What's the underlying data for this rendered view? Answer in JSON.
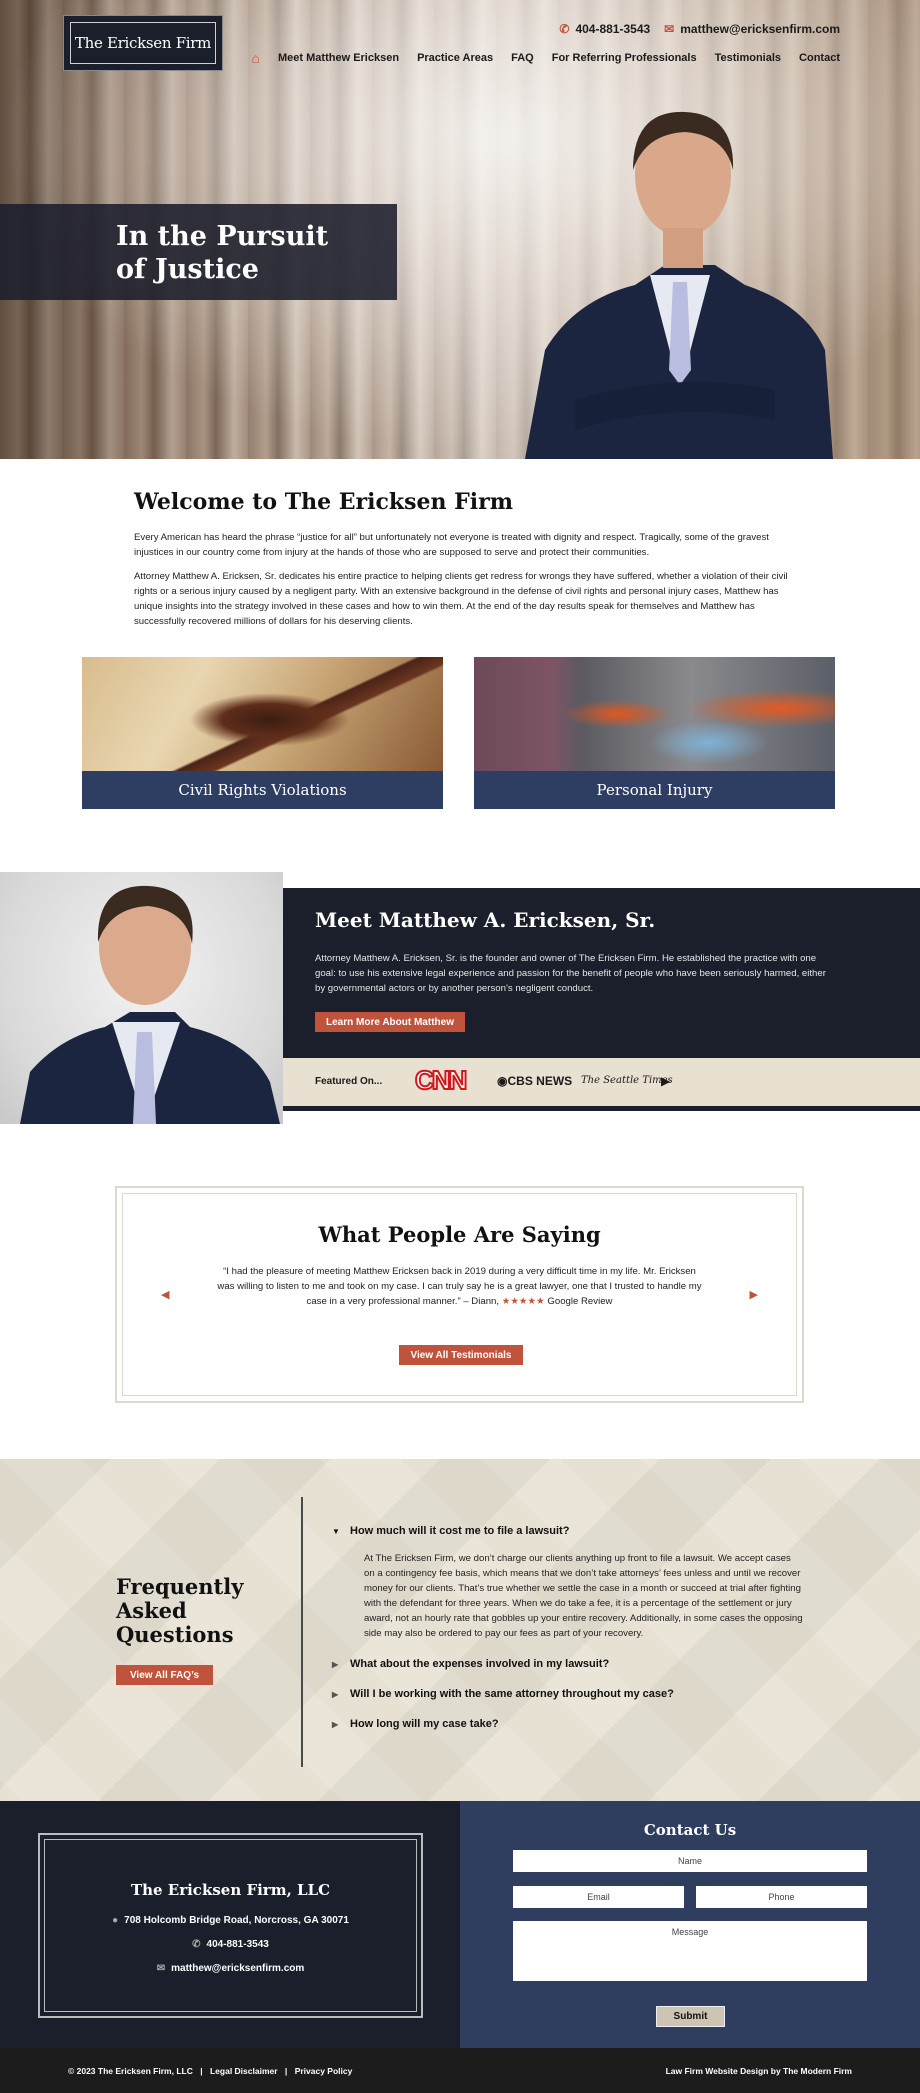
{
  "header": {
    "logo_text": "The Ericksen Firm",
    "phone": "404-881-3543",
    "email": "matthew@ericksenfirm.com",
    "nav": [
      {
        "label": "Meet Matthew Ericksen"
      },
      {
        "label": "Practice Areas"
      },
      {
        "label": "FAQ"
      },
      {
        "label": "For Referring Professionals"
      },
      {
        "label": "Testimonials"
      },
      {
        "label": "Contact"
      }
    ]
  },
  "hero": {
    "headline_line1": "In the Pursuit",
    "headline_line2": "of Justice"
  },
  "welcome": {
    "title": "Welcome to The Ericksen Firm",
    "paragraph1": "Every American has heard the phrase “justice for all” but unfortunately not everyone is treated with dignity and respect. Tragically, some of the gravest injustices in our country come from injury at the hands of those who are supposed to serve and protect their communities.",
    "paragraph2": "Attorney Matthew A. Ericksen, Sr. dedicates his entire practice to helping clients get redress for wrongs they have suffered, whether a violation of their civil rights or a serious injury caused by a negligent party. With an extensive background in the defense of civil rights and personal injury cases, Matthew has unique insights into the strategy involved in these cases and how to win them. At the end of the day results speak for themselves and Matthew has successfully recovered millions of dollars for his deserving clients."
  },
  "practice_areas": [
    {
      "label": "Civil Rights Violations"
    },
    {
      "label": "Personal Injury"
    }
  ],
  "meet": {
    "title": "Meet Matthew A. Ericksen, Sr.",
    "body": "Attorney Matthew A. Ericksen, Sr. is the founder and owner of The Ericksen Firm. He established the practice with one goal: to use his extensive legal experience and passion for the benefit of people who have been seriously harmed, either by governmental actors or by another person’s negligent conduct.",
    "button": "Learn More About Matthew",
    "featured_label": "Featured On...",
    "featured_logos": [
      "CNN",
      "CBS NEWS",
      "The Seattle Times"
    ]
  },
  "testimonials": {
    "title": "What People Are Saying",
    "quote": "“I had the pleasure of meeting Matthew Ericksen back in 2019 during a very difficult time in my life. Mr. Ericksen was willing to listen to me and took on my case. I can truly say he is a great lawyer, one that I trusted to handle my case in a very professional manner.” – Diann,",
    "stars": "★★★★★",
    "rating": 5,
    "source": "Google Review",
    "button": "View All Testimonials"
  },
  "faq": {
    "title": "Frequently Asked Questions",
    "button": "View All FAQ’s",
    "items": [
      {
        "question": "How much will it cost me to file a lawsuit?",
        "open": true,
        "answer": "At The Ericksen Firm, we don’t charge our clients anything up front to file a lawsuit. We accept cases on a contingency fee basis, which means that we don’t take attorneys’ fees unless and until we recover money for our clients. That’s true whether we settle the case in a month or succeed at trial after fighting with the defendant for three years. When we do take a fee, it is a percentage of the settlement or jury award, not an hourly rate that gobbles up your entire recovery. Additionally, in some cases the opposing side may also be ordered to pay our fees as part of your recovery."
      },
      {
        "question": "What about the expenses involved in my lawsuit?",
        "open": false
      },
      {
        "question": "Will I be working with the same attorney throughout my case?",
        "open": false
      },
      {
        "question": "How long will my case take?",
        "open": false
      }
    ]
  },
  "footer": {
    "firm_name": "The Ericksen Firm, LLC",
    "address": "708 Holcomb Bridge Road, Norcross, GA 30071",
    "phone": "404-881-3543",
    "email": "matthew@ericksenfirm.com",
    "contact_title": "Contact Us",
    "form": {
      "name_placeholder": "Name",
      "email_placeholder": "Email",
      "phone_placeholder": "Phone",
      "message_placeholder": "Message",
      "submit": "Submit"
    },
    "copyright": "© 2023 The Ericksen Firm, LLC",
    "legal_link": "Legal Disclaimer",
    "privacy_link": "Privacy Policy",
    "credit": "Law Firm Website Design by The Modern Firm"
  },
  "colors": {
    "accent": "#c0533c",
    "navy_dark": "#1b1e2b",
    "navy": "#2e3e62",
    "beige": "#e7e1d3"
  }
}
